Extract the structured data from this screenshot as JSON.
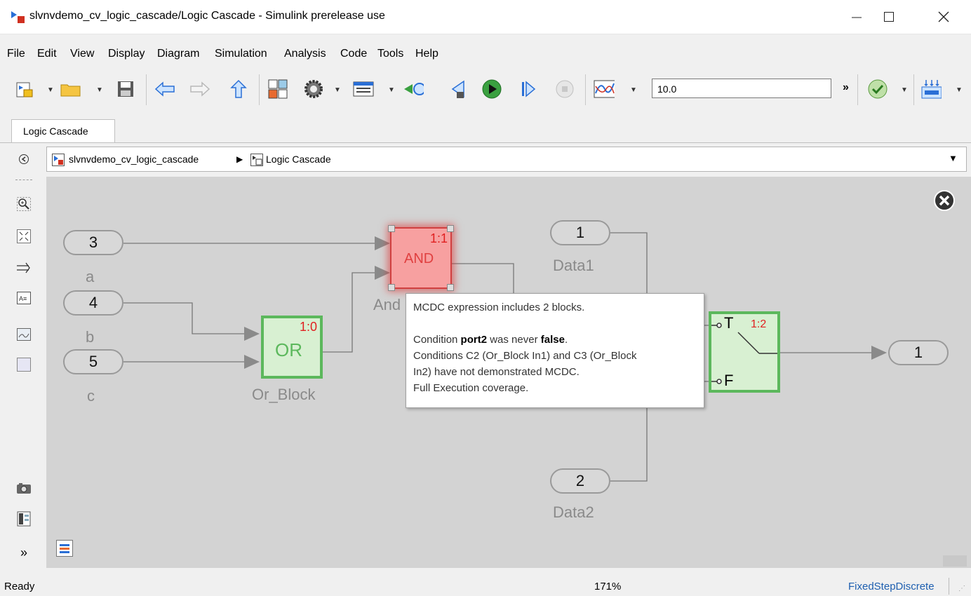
{
  "window": {
    "title": "slvnvdemo_cv_logic_cascade/Logic Cascade - Simulink prerelease use"
  },
  "menu": [
    "File",
    "Edit",
    "View",
    "Display",
    "Diagram",
    "Simulation",
    "Analysis",
    "Code",
    "Tools",
    "Help"
  ],
  "toolbar": {
    "stop_time": "10.0",
    "more": "»"
  },
  "tab": {
    "label": "Logic Cascade"
  },
  "breadcrumb": {
    "root": "slvnvdemo_cv_logic_cascade",
    "current": "Logic Cascade"
  },
  "diagram": {
    "inports": [
      {
        "number": "3",
        "name": "a"
      },
      {
        "number": "4",
        "name": "b"
      },
      {
        "number": "5",
        "name": "c"
      },
      {
        "number": "1",
        "name": "Data1"
      },
      {
        "number": "2",
        "name": "Data2"
      }
    ],
    "outport": {
      "number": "1"
    },
    "or_block": {
      "text": "OR",
      "badge": "1:0",
      "name": "Or_Block"
    },
    "and_block": {
      "text": "AND",
      "badge": "1:1",
      "name_partial": "And"
    },
    "switch_block": {
      "true_label": "T",
      "false_label": "F",
      "badge": "1:2"
    }
  },
  "tooltip": {
    "line1": "MCDC expression includes 2 blocks.",
    "cond_prefix": "Condition ",
    "cond_port": "port2",
    "cond_mid": " was never ",
    "cond_value": "false",
    "cond_end": ".",
    "line3a": "Conditions C2 (Or_Block In1) and C3 (Or_Block",
    "line3b": "In2) have not demonstrated MCDC.",
    "line4": "Full Execution coverage."
  },
  "status": {
    "left": "Ready",
    "zoom": "171%",
    "solver": "FixedStepDiscrete"
  },
  "colors": {
    "and_fill": "#f7a0a0",
    "block_green_border": "#5cb85c",
    "block_green_fill": "#d8f0d2",
    "badge_red": "#e02020"
  }
}
